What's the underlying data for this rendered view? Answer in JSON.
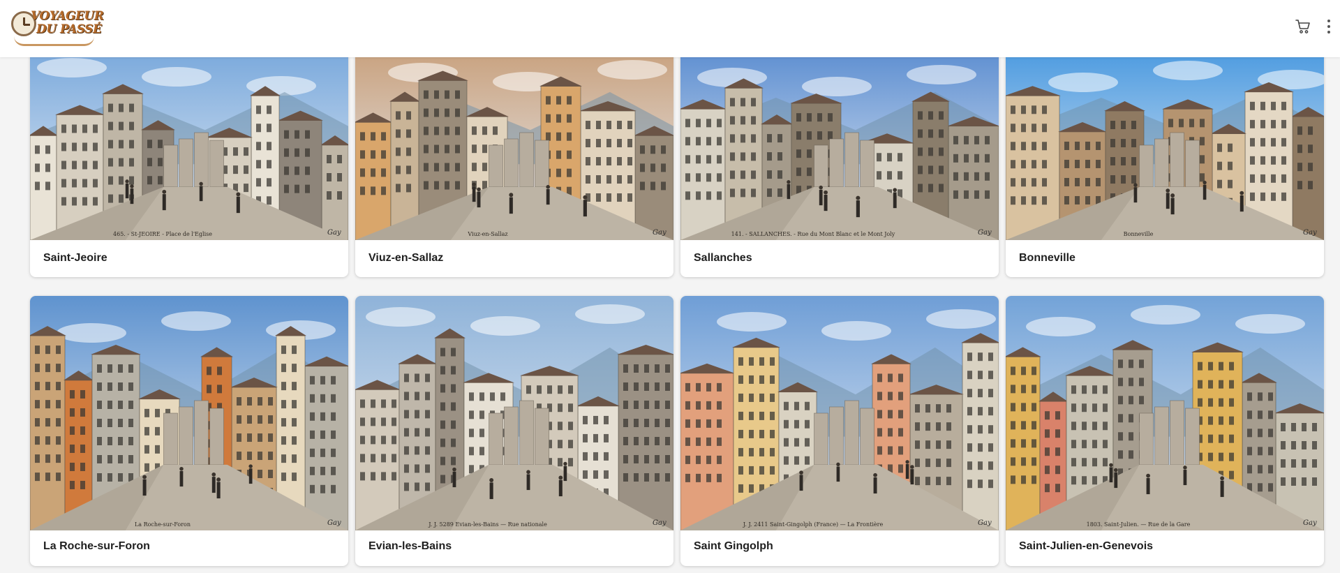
{
  "brand": {
    "line1": "VOYAGEUR",
    "line2": "DU PASSÉ"
  },
  "header": {
    "cart_icon": "cart-icon",
    "menu_icon": "more-vert-icon"
  },
  "cards": [
    {
      "title": "Saint-Jeoire",
      "caption": "465. - St-JEOIRE - Place de l'Eglise",
      "sky": "#7aa9dc"
    },
    {
      "title": "Viuz-en-Sallaz",
      "caption": "Viuz-en-Sallaz",
      "sky": "#c9a27f"
    },
    {
      "title": "Sallanches",
      "caption": "141. - SALLANCHES. - Rue du Mont Blanc et le Mont Joly",
      "sky": "#5e8fd1"
    },
    {
      "title": "Bonneville",
      "caption": "Bonneville",
      "sky": "#4d9be0"
    },
    {
      "title": "La Roche-sur-Foron",
      "caption": "La Roche-sur-Foron",
      "sky": "#5f93cf"
    },
    {
      "title": "Evian-les-Bains",
      "caption": "J. J. 5289   Evian-les-Bains — Rue nationale",
      "sky": "#8fb3d9"
    },
    {
      "title": "Saint Gingolph",
      "caption": "J. J. 2411   Saint-Gingolph (France) — La Frontière",
      "sky": "#6f9ed6"
    },
    {
      "title": "Saint-Julien-en-Genevois",
      "caption": "1803. Saint-Julien. — Rue de la Gare",
      "sky": "#73a3d8"
    }
  ]
}
